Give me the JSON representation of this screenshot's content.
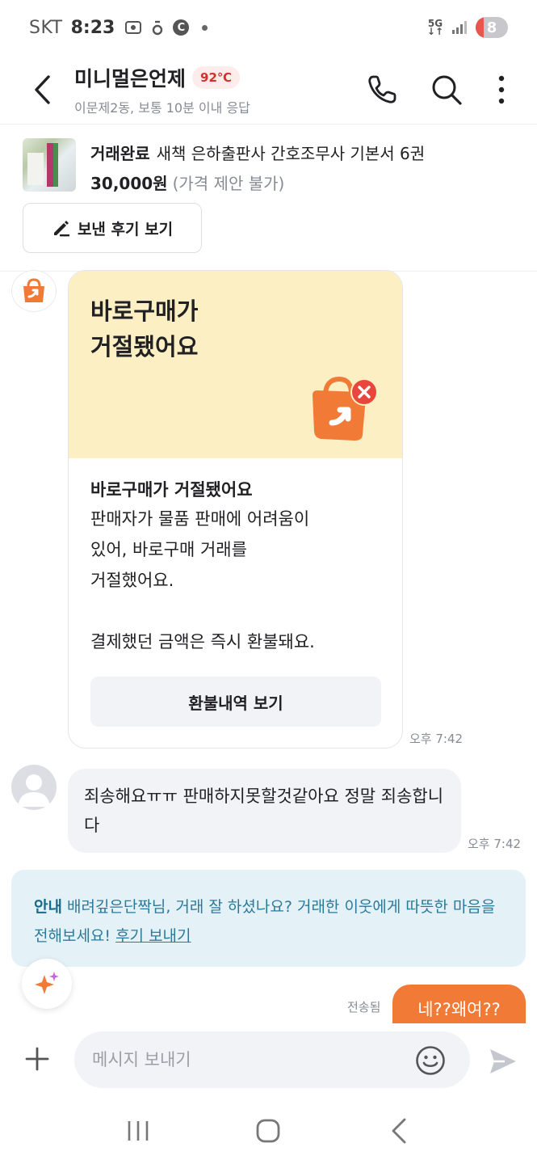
{
  "status_bar": {
    "carrier": "SKT",
    "time": "8:23",
    "notif_c": "C",
    "network_top": "5G",
    "network_arrows": "↓↑",
    "battery": "8",
    "battery_level": 0.08
  },
  "header": {
    "name": "미니멀은언제",
    "temperature": "92℃",
    "subtitle": "이문제2동, 보통 10분 이내 응답"
  },
  "product": {
    "status": "거래완료",
    "title": "새책 은하출판사 간호조무사 기본서 6권",
    "price": "30,000원",
    "price_note": "(가격 제안 불가)",
    "review_button": "보낸 후기 보기"
  },
  "card": {
    "headline": "바로구매가\n거절됐어요",
    "title": "바로구매가 거절됐어요",
    "description": "판매자가 물품 판매에 어려움이\n있어, 바로구매 거래를\n거절했어요.",
    "refund_note": "결제했던 금액은 즉시 환불돼요.",
    "button": "환불내역 보기",
    "time": "오후 7:42"
  },
  "incoming": {
    "text": "죄송해요ㅠㅠ 판매하지못할것같아요 정말 죄송합니다",
    "time": "오후 7:42"
  },
  "notice": {
    "label": "안내",
    "text": "배려깊은단짝님, 거래 잘 하셨나요? 거래한 이웃에게 따뜻한 마음을 전해보세요!",
    "link": "후기 보내기"
  },
  "outgoing": {
    "status": "전송됨",
    "text": "네??왜여??"
  },
  "input": {
    "placeholder": "메시지 보내기"
  },
  "colors": {
    "accent": "#f07a36",
    "temperature": "#d3322a",
    "card_top": "#fcefc3",
    "notice_bg": "#e4f2f8",
    "notice_text": "#2b7a9a"
  }
}
